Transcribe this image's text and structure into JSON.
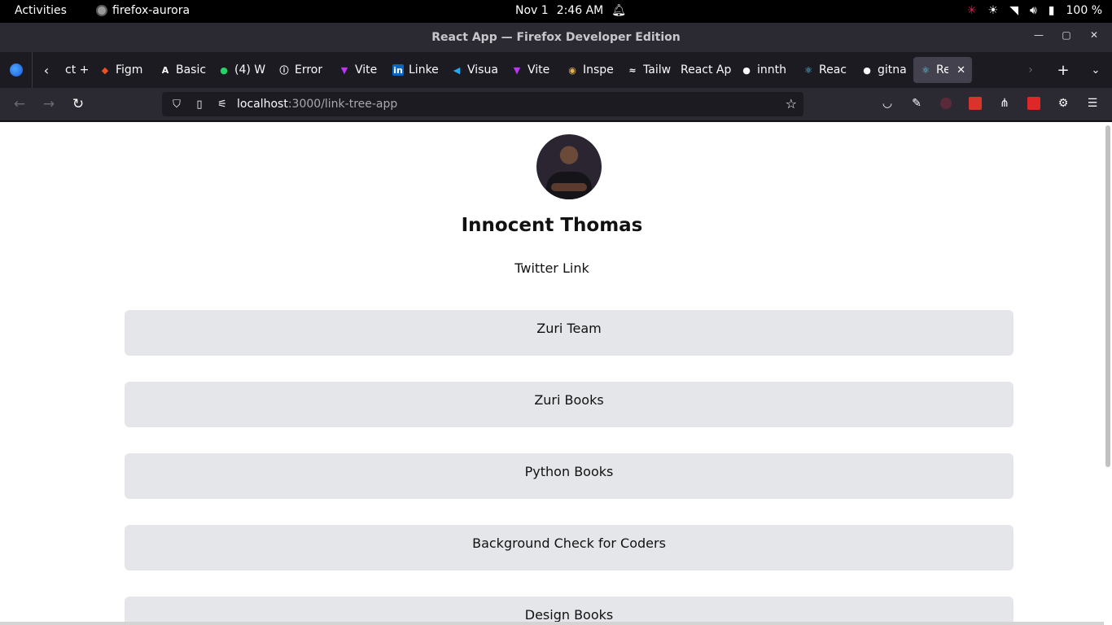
{
  "system": {
    "activities": "Activities",
    "app_name": "firefox-aurora",
    "date": "Nov 1",
    "time": "2:46 AM",
    "battery": "100 %"
  },
  "window": {
    "title": "React App — Firefox Developer Edition"
  },
  "tabs": [
    {
      "label": "ct +",
      "favicon": ""
    },
    {
      "label": "Figm",
      "favicon": "figma-icon"
    },
    {
      "label": "Basic",
      "favicon": "angular-icon"
    },
    {
      "label": "(4) W",
      "favicon": "whatsapp-icon"
    },
    {
      "label": "Error",
      "favicon": "info-icon"
    },
    {
      "label": "Vite",
      "favicon": "vite-icon"
    },
    {
      "label": "Linke",
      "favicon": "linkedin-icon"
    },
    {
      "label": "Visua",
      "favicon": "vscode-icon"
    },
    {
      "label": "Vite",
      "favicon": "vite-icon"
    },
    {
      "label": "Inspe",
      "favicon": "inspect-icon"
    },
    {
      "label": "Tailw",
      "favicon": "tailwind-icon"
    },
    {
      "label": "React Ap",
      "favicon": ""
    },
    {
      "label": "innth",
      "favicon": "github-icon"
    },
    {
      "label": "Reac",
      "favicon": "react-icon"
    },
    {
      "label": "gitna",
      "favicon": "github-icon"
    },
    {
      "label": "Re",
      "favicon": "react-icon",
      "active": true
    }
  ],
  "urlbar": {
    "host": "localhost",
    "path": ":3000/link-tree-app"
  },
  "page": {
    "name": "Innocent Thomas",
    "twitter_link": "Twitter Link",
    "links": [
      "Zuri Team",
      "Zuri Books",
      "Python Books",
      "Background Check for Coders",
      "Design Books"
    ]
  },
  "colors": {
    "link_bg": "#e5e6ea",
    "chrome_dark": "#1c1b22",
    "chrome_mid": "#2b2a33"
  }
}
